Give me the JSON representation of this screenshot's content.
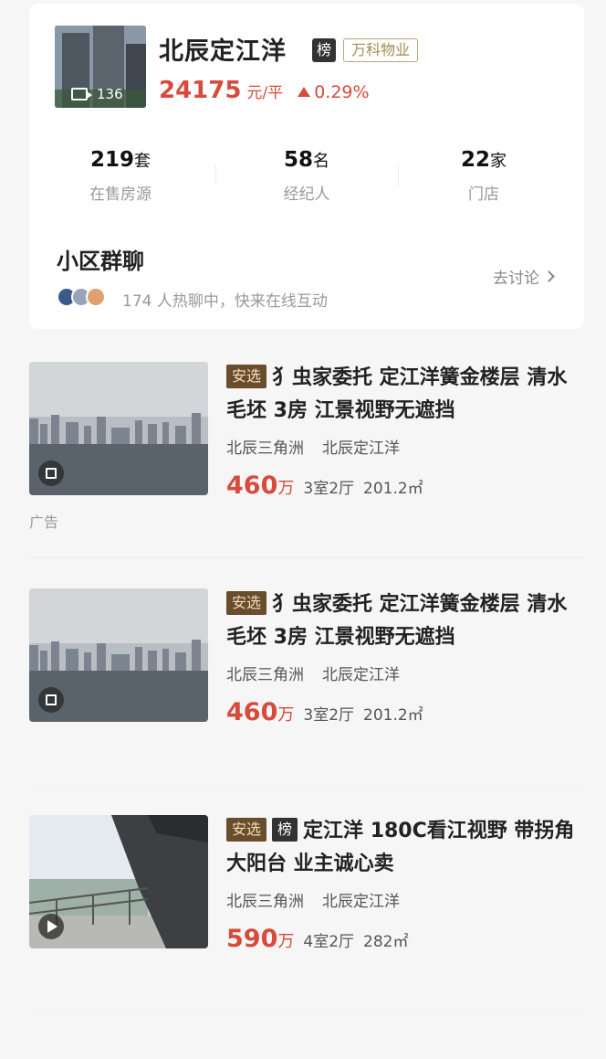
{
  "community": {
    "name": "北辰定江洋",
    "rank_badge": "榜",
    "property_mgmt": "万科物业",
    "video_count": "136",
    "price": "24175",
    "price_unit": "元/平",
    "price_change": "0.29%",
    "stats": [
      {
        "value": "219",
        "unit": "套",
        "label": "在售房源"
      },
      {
        "value": "58",
        "unit": "名",
        "label": "经纪人"
      },
      {
        "value": "22",
        "unit": "家",
        "label": "门店"
      }
    ]
  },
  "chat": {
    "title": "小区群聊",
    "link": "去讨论",
    "subtitle": "174 人热聊中，快来在线互动"
  },
  "listings": [
    {
      "tag": "安选",
      "rank_tag": "",
      "title": "犭虫家委托 定江洋簧金楼层 清水毛坯 3房 江景视野无遮挡",
      "area_name": "北辰三角洲",
      "community": "北辰定江洋",
      "price": "460",
      "price_unit": "万",
      "layout": "3室2厅",
      "size": "201.2㎡",
      "ad_label": "广告",
      "media_icon": "gallery-icon"
    },
    {
      "tag": "安选",
      "rank_tag": "",
      "title": "犭虫家委托 定江洋簧金楼层 清水毛坯 3房 江景视野无遮挡",
      "area_name": "北辰三角洲",
      "community": "北辰定江洋",
      "price": "460",
      "price_unit": "万",
      "layout": "3室2厅",
      "size": "201.2㎡",
      "media_icon": "gallery-icon"
    },
    {
      "tag": "安选",
      "rank_tag": "榜",
      "title": "定江洋 180C看江视野 带拐角大阳台 业主诚心卖",
      "area_name": "北辰三角洲",
      "community": "北辰定江洋",
      "price": "590",
      "price_unit": "万",
      "layout": "4室2厅",
      "size": "282㎡",
      "media_icon": "play-icon"
    }
  ],
  "colors": {
    "price_red": "#d84a3c",
    "tag_brown": "#6a4d2d",
    "gold_text": "#a48b52"
  }
}
